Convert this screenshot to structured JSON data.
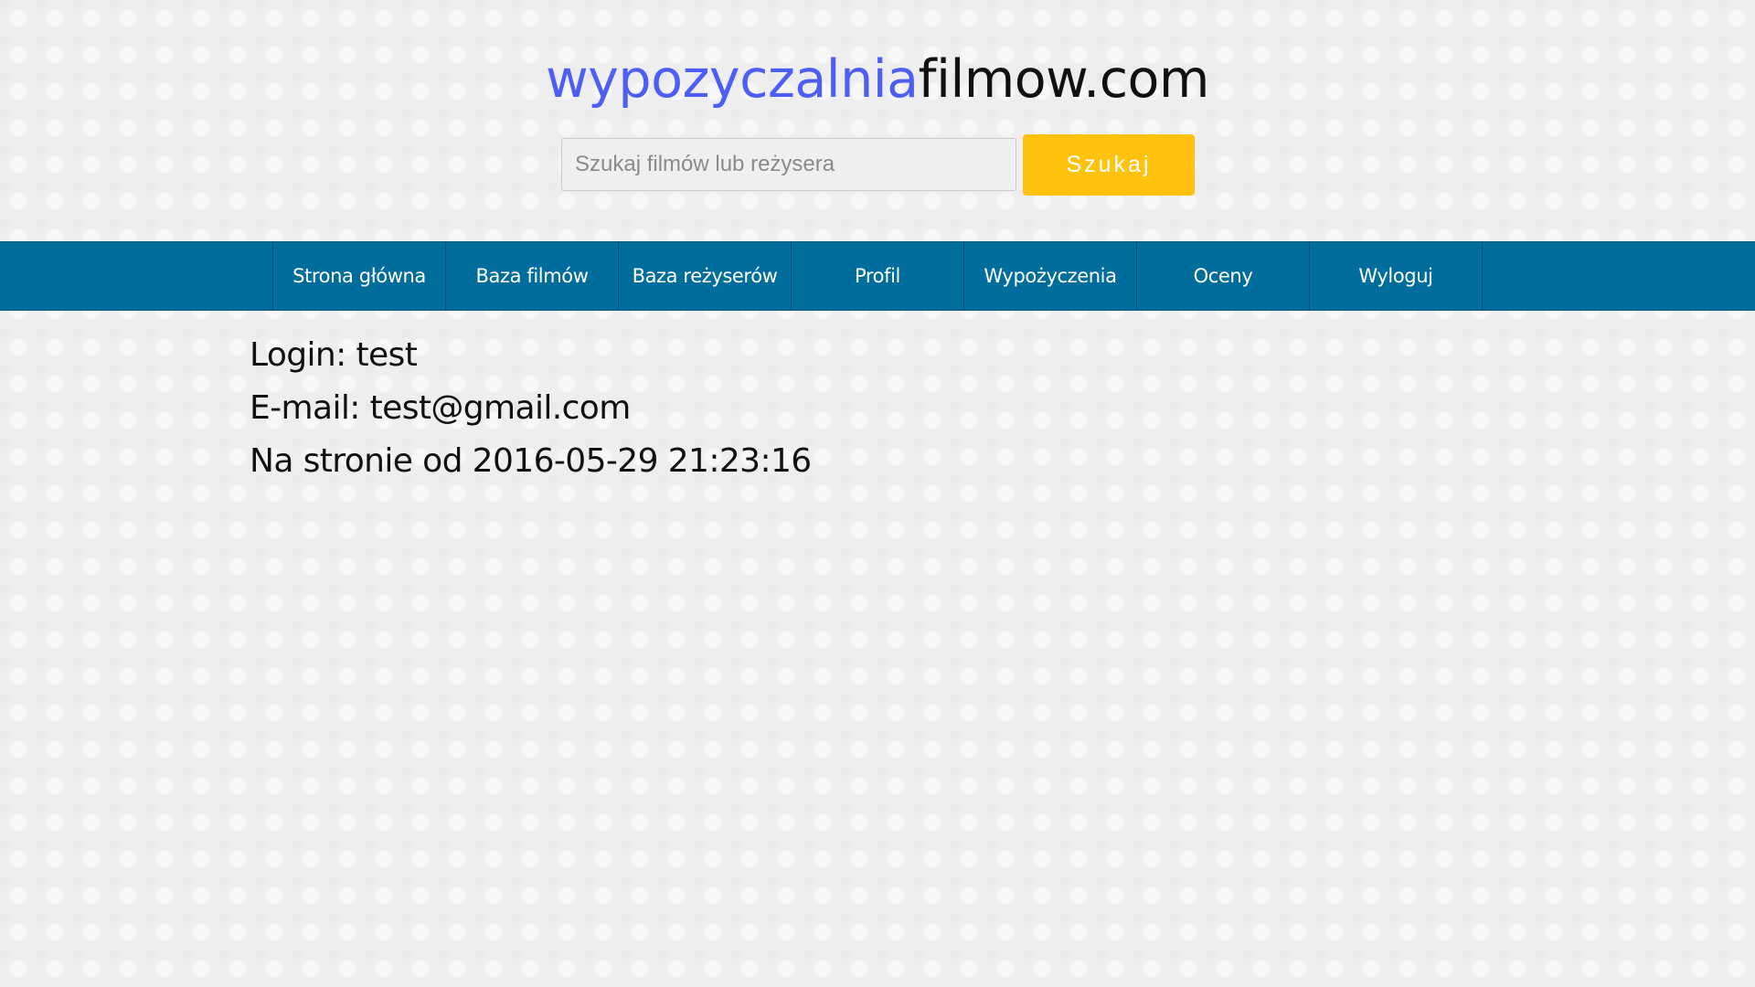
{
  "site": {
    "logo_accent": "wypozyczalnia",
    "logo_rest": "filmow.com",
    "accent_color": "#4d5ef2"
  },
  "search": {
    "placeholder": "Szukaj filmów lub reżysera",
    "value": "",
    "button_label": "Szukaj",
    "button_color": "#ffc20e"
  },
  "nav": {
    "bar_color": "#006d9c",
    "items": [
      {
        "label": "Strona główna"
      },
      {
        "label": "Baza filmów"
      },
      {
        "label": "Baza reżyserów"
      },
      {
        "label": "Profil"
      },
      {
        "label": "Wypożyczenia"
      },
      {
        "label": "Oceny"
      },
      {
        "label": "Wyloguj"
      }
    ]
  },
  "profile": {
    "login_line": "Login: test",
    "email_line": "E-mail: test@gmail.com",
    "since_line": "Na stronie od 2016-05-29 21:23:16"
  }
}
